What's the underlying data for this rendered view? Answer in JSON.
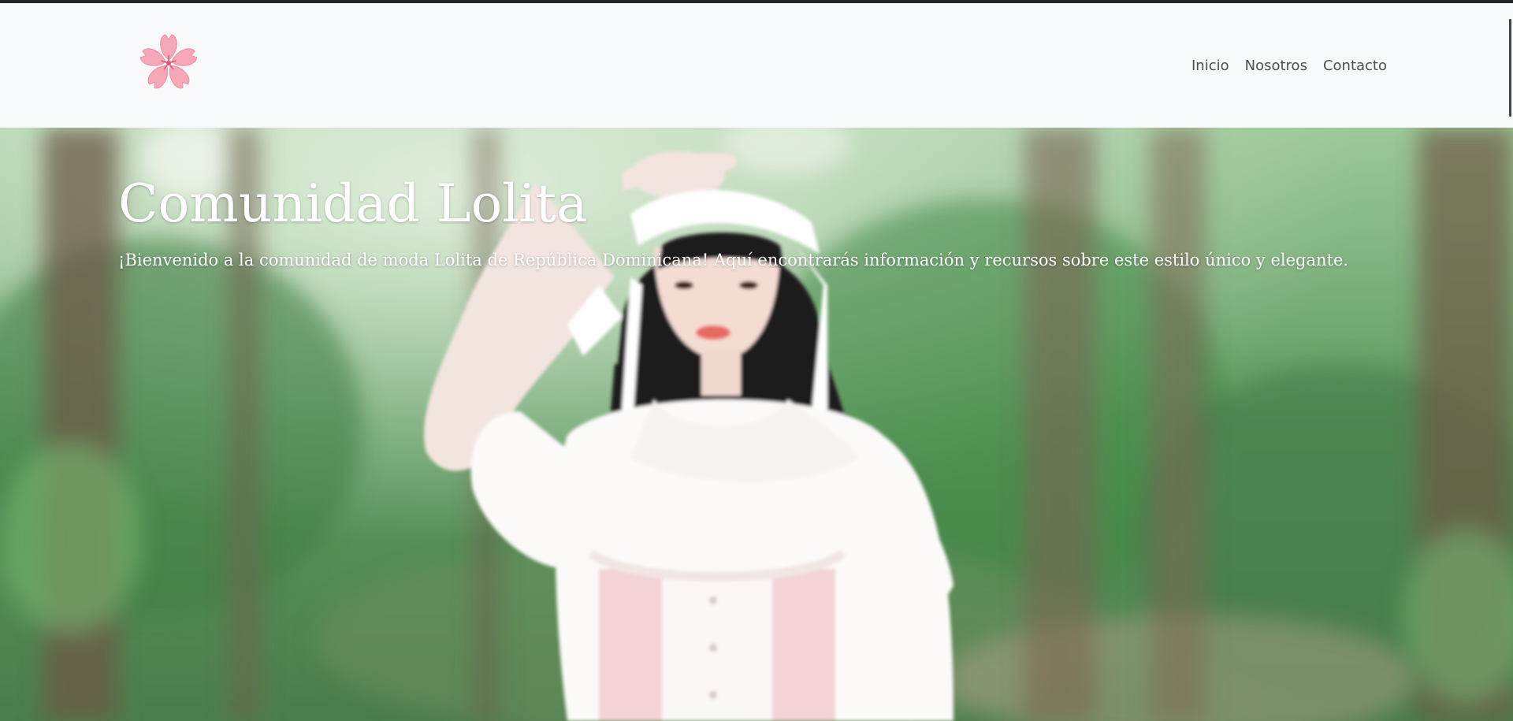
{
  "nav": {
    "logo_icon": "sakura-flower-icon",
    "links": [
      {
        "label": "Inicio"
      },
      {
        "label": "Nosotros"
      },
      {
        "label": "Contacto"
      }
    ]
  },
  "hero": {
    "title": "Comunidad Lolita",
    "subtitle": "¡Bienvenido a la comunidad de moda Lolita de República Dominicana! Aquí encontrarás información y recursos sobre este estilo único y elegante.",
    "image_icon": "lolita-girl-forest-photo"
  },
  "colors": {
    "navbar_bg": "#f8f9fa",
    "nav_text": "#4a4f55",
    "top_border": "#212529",
    "logo_pink": "#f7a8b8",
    "hero_text": "#ffffff"
  }
}
